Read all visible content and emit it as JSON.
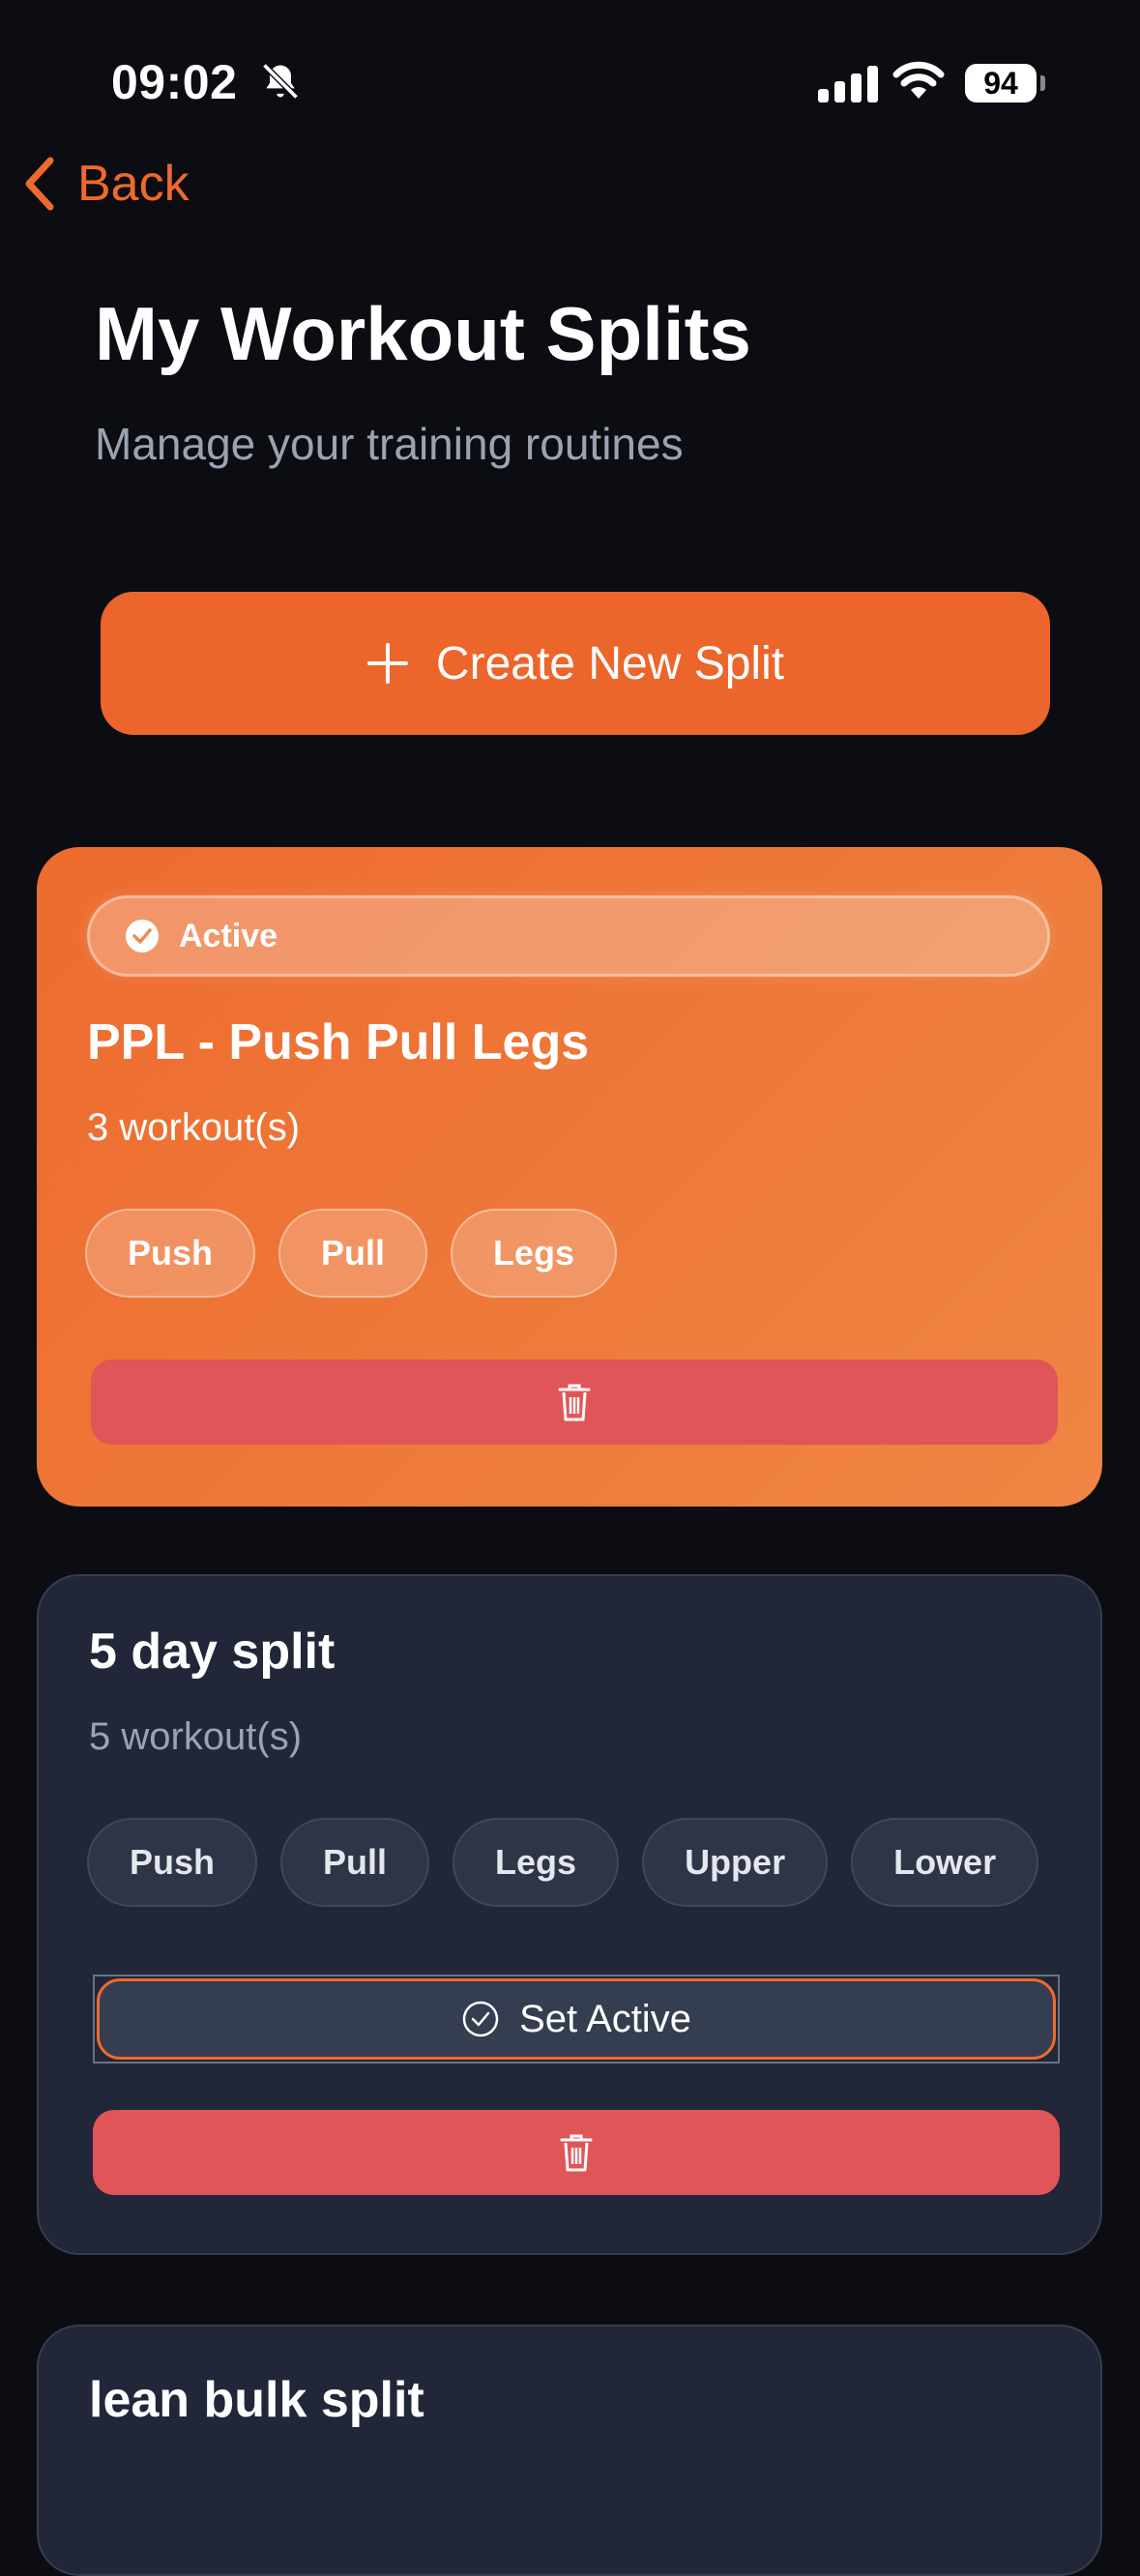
{
  "status_bar": {
    "time": "09:02",
    "battery": "94"
  },
  "nav": {
    "back_label": "Back"
  },
  "header": {
    "title": "My Workout Splits",
    "subtitle": "Manage your training routines"
  },
  "create_button": {
    "label": "Create New Split"
  },
  "splits": [
    {
      "name": "PPL - Push Pull Legs",
      "count": "3 workout(s)",
      "badge": "Active",
      "active": true,
      "tags": [
        "Push",
        "Pull",
        "Legs"
      ]
    },
    {
      "name": "5 day split",
      "count": "5 workout(s)",
      "active": false,
      "set_active_label": "Set Active",
      "tags": [
        "Push",
        "Pull",
        "Legs",
        "Upper",
        "Lower"
      ]
    },
    {
      "name": "lean bulk split",
      "active": false
    }
  ],
  "colors": {
    "background": "#0b0d12",
    "accent": "#ee6a2c",
    "card_dark": "#212638",
    "delete": "#e05558"
  },
  "icons": {
    "back": "chevron-left-icon",
    "muted": "bell-slash-icon",
    "plus": "plus-icon",
    "check": "check-circle-icon",
    "delete": "trash-icon"
  }
}
